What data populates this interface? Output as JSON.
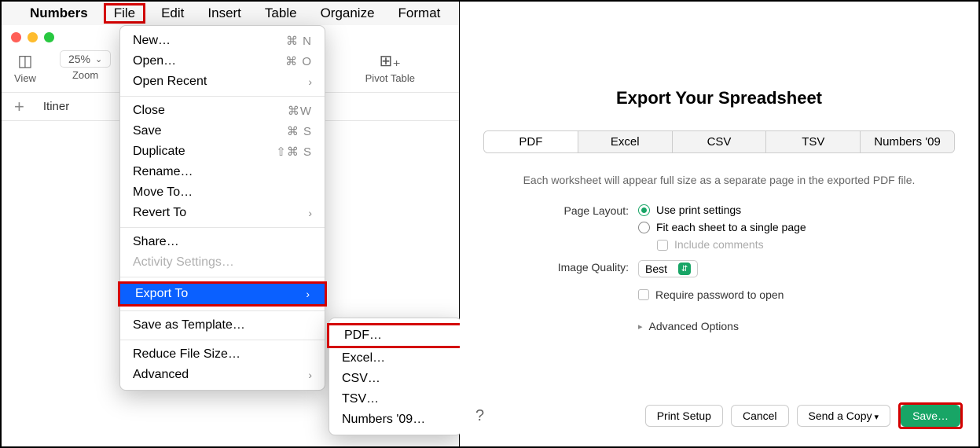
{
  "menubar": {
    "app": "Numbers",
    "items": [
      "File",
      "Edit",
      "Insert",
      "Table",
      "Organize",
      "Format"
    ]
  },
  "toolbar": {
    "view": "View",
    "zoom_label": "Zoom",
    "zoom_value": "25%",
    "pivot": "Pivot Table"
  },
  "tabs": {
    "sheet0": "Itiner"
  },
  "file_menu": {
    "new": "New…",
    "new_sc": "⌘ N",
    "open": "Open…",
    "open_sc": "⌘ O",
    "open_recent": "Open Recent",
    "close": "Close",
    "close_sc": "⌘W",
    "save": "Save",
    "save_sc": "⌘ S",
    "duplicate": "Duplicate",
    "dup_sc": "⇧⌘ S",
    "rename": "Rename…",
    "move_to": "Move To…",
    "revert_to": "Revert To",
    "share": "Share…",
    "activity": "Activity Settings…",
    "export_to": "Export To",
    "save_template": "Save as Template…",
    "reduce": "Reduce File Size…",
    "advanced": "Advanced"
  },
  "export_submenu": {
    "pdf": "PDF…",
    "excel": "Excel…",
    "csv": "CSV…",
    "tsv": "TSV…",
    "numbers09": "Numbers '09…"
  },
  "dialog": {
    "title": "Export Your Spreadsheet",
    "tabs": [
      "PDF",
      "Excel",
      "CSV",
      "TSV",
      "Numbers '09"
    ],
    "description": "Each worksheet will appear full size as a separate page in the exported PDF file.",
    "page_layout_label": "Page Layout:",
    "r1": "Use print settings",
    "r2": "Fit each sheet to a single page",
    "include_comments": "Include comments",
    "img_q_label": "Image Quality:",
    "img_q_value": "Best",
    "require_pw": "Require password to open",
    "advanced": "Advanced Options",
    "help": "?",
    "btn_print": "Print Setup",
    "btn_cancel": "Cancel",
    "btn_send": "Send a Copy",
    "btn_save": "Save…"
  }
}
